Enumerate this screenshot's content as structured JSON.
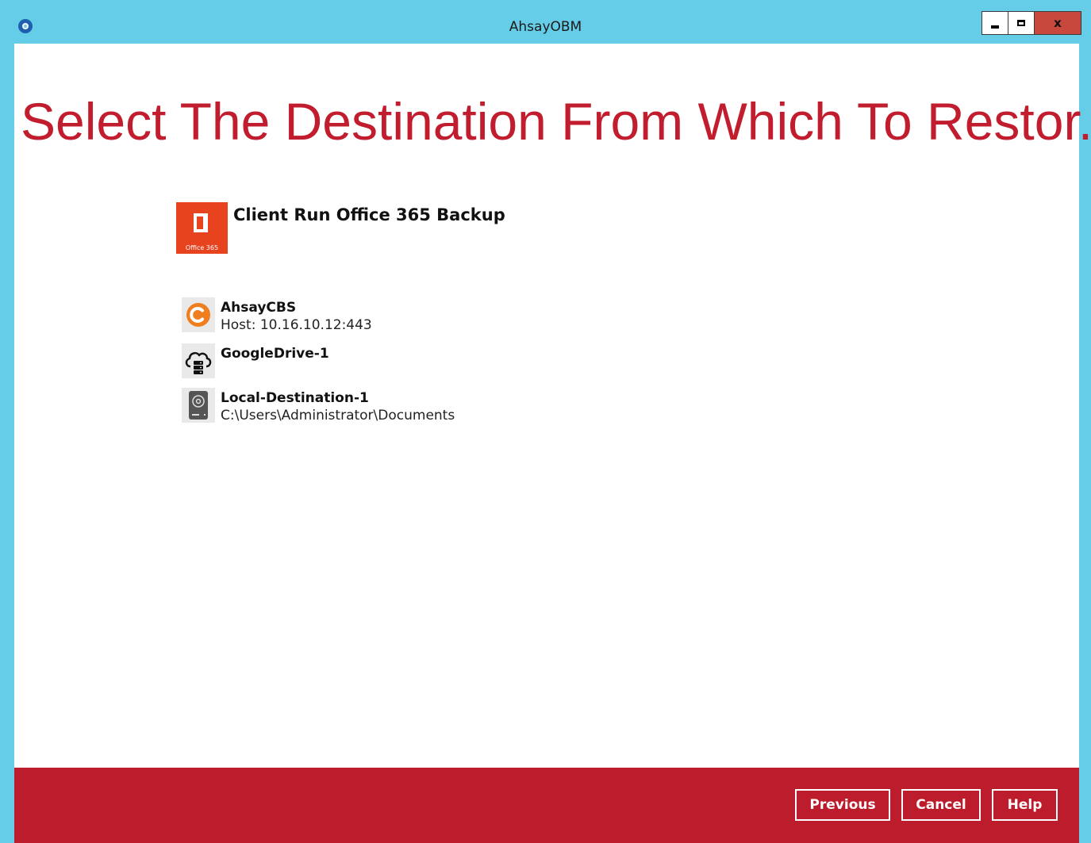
{
  "window": {
    "title": "AhsayOBM",
    "app_icon": "ahsay-logo-icon",
    "controls": {
      "minimize": "minimize-icon",
      "maximize": "maximize-icon",
      "close": "x"
    }
  },
  "page": {
    "heading": "Select The Destination From Which To Restor..."
  },
  "backup_set": {
    "name": "Client Run Office 365 Backup",
    "icon_caption": "Office 365",
    "icon": "office365-icon"
  },
  "destinations": [
    {
      "name": "AhsayCBS",
      "detail": "Host: 10.16.10.12:443",
      "icon": "ahsaycbs-icon"
    },
    {
      "name": "GoogleDrive-1",
      "detail": "",
      "icon": "cloud-server-icon"
    },
    {
      "name": "Local-Destination-1",
      "detail": "C:\\Users\\Administrator\\Documents",
      "icon": "hard-drive-icon"
    }
  ],
  "footer": {
    "previous_label": "Previous",
    "cancel_label": "Cancel",
    "help_label": "Help"
  },
  "colors": {
    "titlebar": "#66cde8",
    "accent_red": "#bc1c2c",
    "heading_red": "#c21d2e",
    "office_orange": "#e8431f",
    "cbs_orange": "#f07d1e"
  }
}
